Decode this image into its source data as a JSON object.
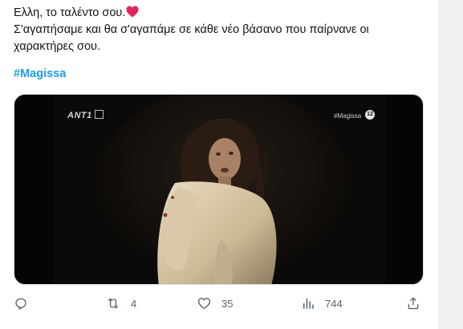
{
  "tweet": {
    "text_line1": "Ελλη, το ταλέντο σου.",
    "text_line2": "Σ'αγαπήσαμε και θα σ'αγαπάμε σε κάθε νέο βάσανο που παίρνανε οι",
    "text_line3": "χαρακτήρες σου.",
    "emoji": "red-heart",
    "hashtag": "#Magissa"
  },
  "media": {
    "type": "video-still",
    "channel_logo": "ANT1",
    "overlay_hashtag": "#Magissa",
    "rating_badge": "12"
  },
  "actions": {
    "reply_count": "",
    "retweet_count": "4",
    "like_count": "35",
    "views_count": "744"
  },
  "colors": {
    "text": "#0f1419",
    "hashtag": "#1d9bf0",
    "icons": "#536471",
    "heart": "#e0245e"
  }
}
